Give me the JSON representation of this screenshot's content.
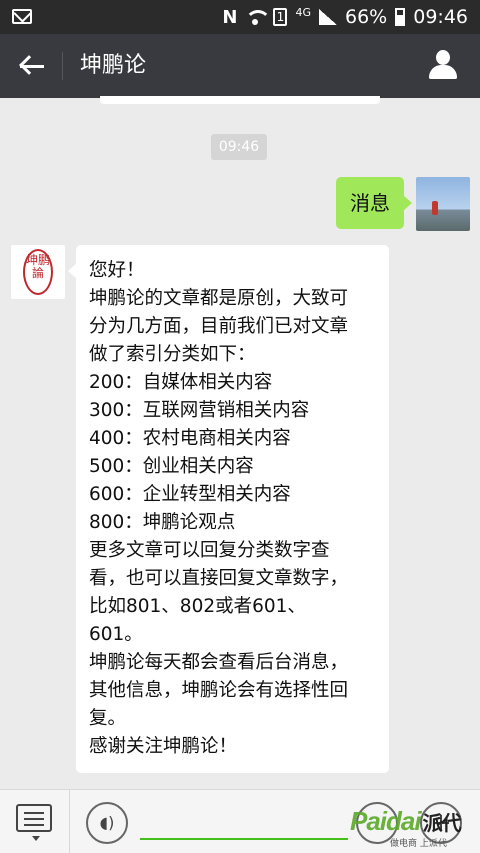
{
  "status_bar": {
    "nfc": "N",
    "sim": "1",
    "network": "4G",
    "battery": "66%",
    "time": "09:46"
  },
  "header": {
    "title": "坤鹏论"
  },
  "chat": {
    "timestamp": "09:46",
    "sent_message": "消息",
    "received_lines": [
      "您好！",
      "坤鹏论的文章都是原创，大致可",
      "分为几方面，目前我们已对文章",
      "做了索引分类如下：",
      "200：自媒体相关内容",
      "300：互联网营销相关内容",
      "400：农村电商相关内容",
      "500：创业相关内容",
      "600：企业转型相关内容",
      "800：坤鹏论观点",
      "更多文章可以回复分类数字查",
      "看，也可以直接回复文章数字，",
      "比如801、802或者601、",
      "601。",
      "坤鹏论每天都会查看后台消息，",
      "其他信息，坤鹏论会有选择性回",
      "复。",
      "感谢关注坤鹏论！"
    ],
    "bot_avatar_seal": "坤鹏論"
  },
  "watermark": {
    "brand": "Paidai",
    "cn": "派代",
    "sub": "做电商 上派代"
  },
  "colors": {
    "header_bg": "#393a3f",
    "sent_bubble": "#a0e75a",
    "input_accent": "#45c01a",
    "seal_red": "#c0282d"
  }
}
